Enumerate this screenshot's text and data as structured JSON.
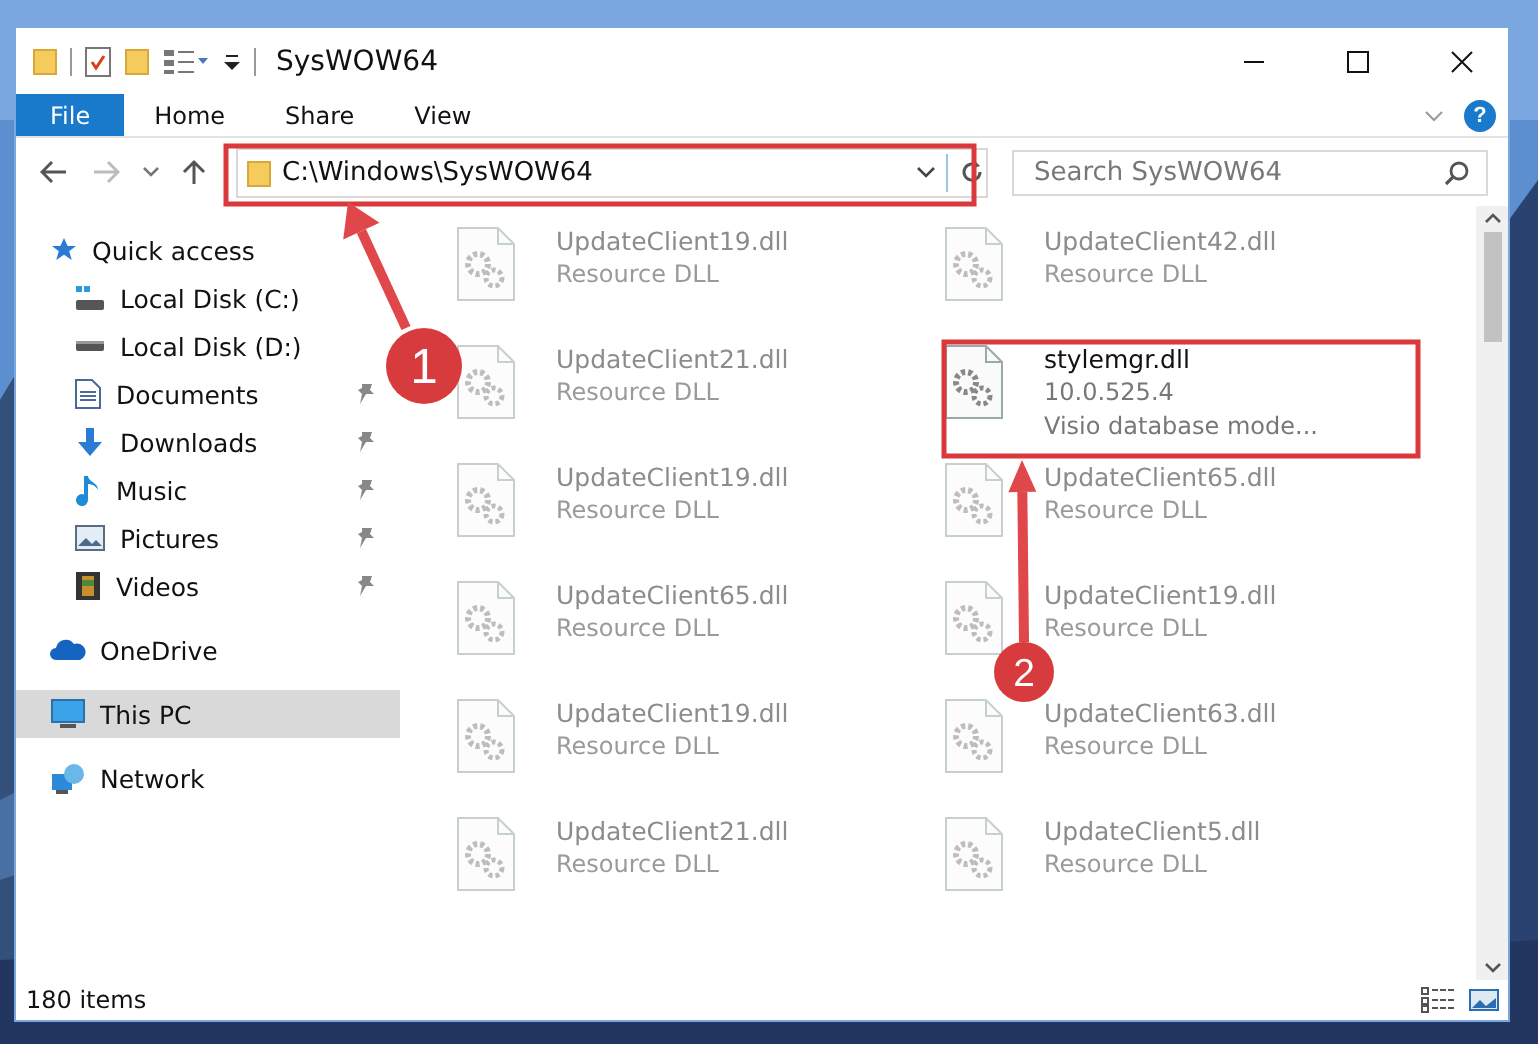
{
  "window": {
    "title": "SysWOW64"
  },
  "ribbon": {
    "tabs": [
      {
        "label": "File",
        "selected": true
      },
      {
        "label": "Home",
        "selected": false
      },
      {
        "label": "Share",
        "selected": false
      },
      {
        "label": "View",
        "selected": false
      }
    ],
    "help": "?"
  },
  "address": {
    "path": "C:\\Windows\\SysWOW64",
    "search_placeholder": "Search SysWOW64"
  },
  "navigation": [
    {
      "label": "Quick access",
      "kind": "star",
      "selected": false,
      "children": [
        {
          "label": "Local Disk (C:)",
          "kind": "system-drive",
          "pinned": false,
          "selected": false
        },
        {
          "label": "Local Disk (D:)",
          "kind": "drive",
          "pinned": false,
          "selected": false
        },
        {
          "label": "Documents",
          "kind": "documents",
          "pinned": true,
          "selected": false
        },
        {
          "label": "Downloads",
          "kind": "download",
          "pinned": true,
          "selected": false
        },
        {
          "label": "Music",
          "kind": "music",
          "pinned": true,
          "selected": false
        },
        {
          "label": "Pictures",
          "kind": "pictures",
          "pinned": true,
          "selected": false
        },
        {
          "label": "Videos",
          "kind": "videos",
          "pinned": true,
          "selected": false
        }
      ]
    },
    {
      "label": "OneDrive",
      "kind": "cloud",
      "selected": false
    },
    {
      "label": "This PC",
      "kind": "pc",
      "selected": true
    },
    {
      "label": "Network",
      "kind": "network",
      "selected": false
    }
  ],
  "files": [
    {
      "name": "UpdateClient19.dll",
      "detail": [
        "Resource DLL"
      ],
      "blurred": true
    },
    {
      "name": "UpdateClient42.dll",
      "detail": [
        "Resource DLL"
      ],
      "blurred": true
    },
    {
      "name": "UpdateClient21.dll",
      "detail": [
        "Resource DLL"
      ],
      "blurred": true
    },
    {
      "name": "stylemgr.dll",
      "detail": [
        "10.0.525.4",
        "Visio database mode..."
      ],
      "blurred": false
    },
    {
      "name": "UpdateClient19.dll",
      "detail": [
        "Resource DLL"
      ],
      "blurred": true
    },
    {
      "name": "UpdateClient65.dll",
      "detail": [
        "Resource DLL"
      ],
      "blurred": true
    },
    {
      "name": "UpdateClient65.dll",
      "detail": [
        "Resource DLL"
      ],
      "blurred": true
    },
    {
      "name": "UpdateClient19.dll",
      "detail": [
        "Resource DLL"
      ],
      "blurred": true
    },
    {
      "name": "UpdateClient19.dll",
      "detail": [
        "Resource DLL"
      ],
      "blurred": true
    },
    {
      "name": "UpdateClient63.dll",
      "detail": [
        "Resource DLL"
      ],
      "blurred": true
    },
    {
      "name": "UpdateClient21.dll",
      "detail": [
        "Resource DLL"
      ],
      "blurred": true
    },
    {
      "name": "UpdateClient5.dll",
      "detail": [
        "Resource DLL"
      ],
      "blurred": true
    }
  ],
  "status_bar": {
    "count": "180 items"
  },
  "annotations": [
    {
      "label": "1"
    },
    {
      "label": "2"
    }
  ]
}
